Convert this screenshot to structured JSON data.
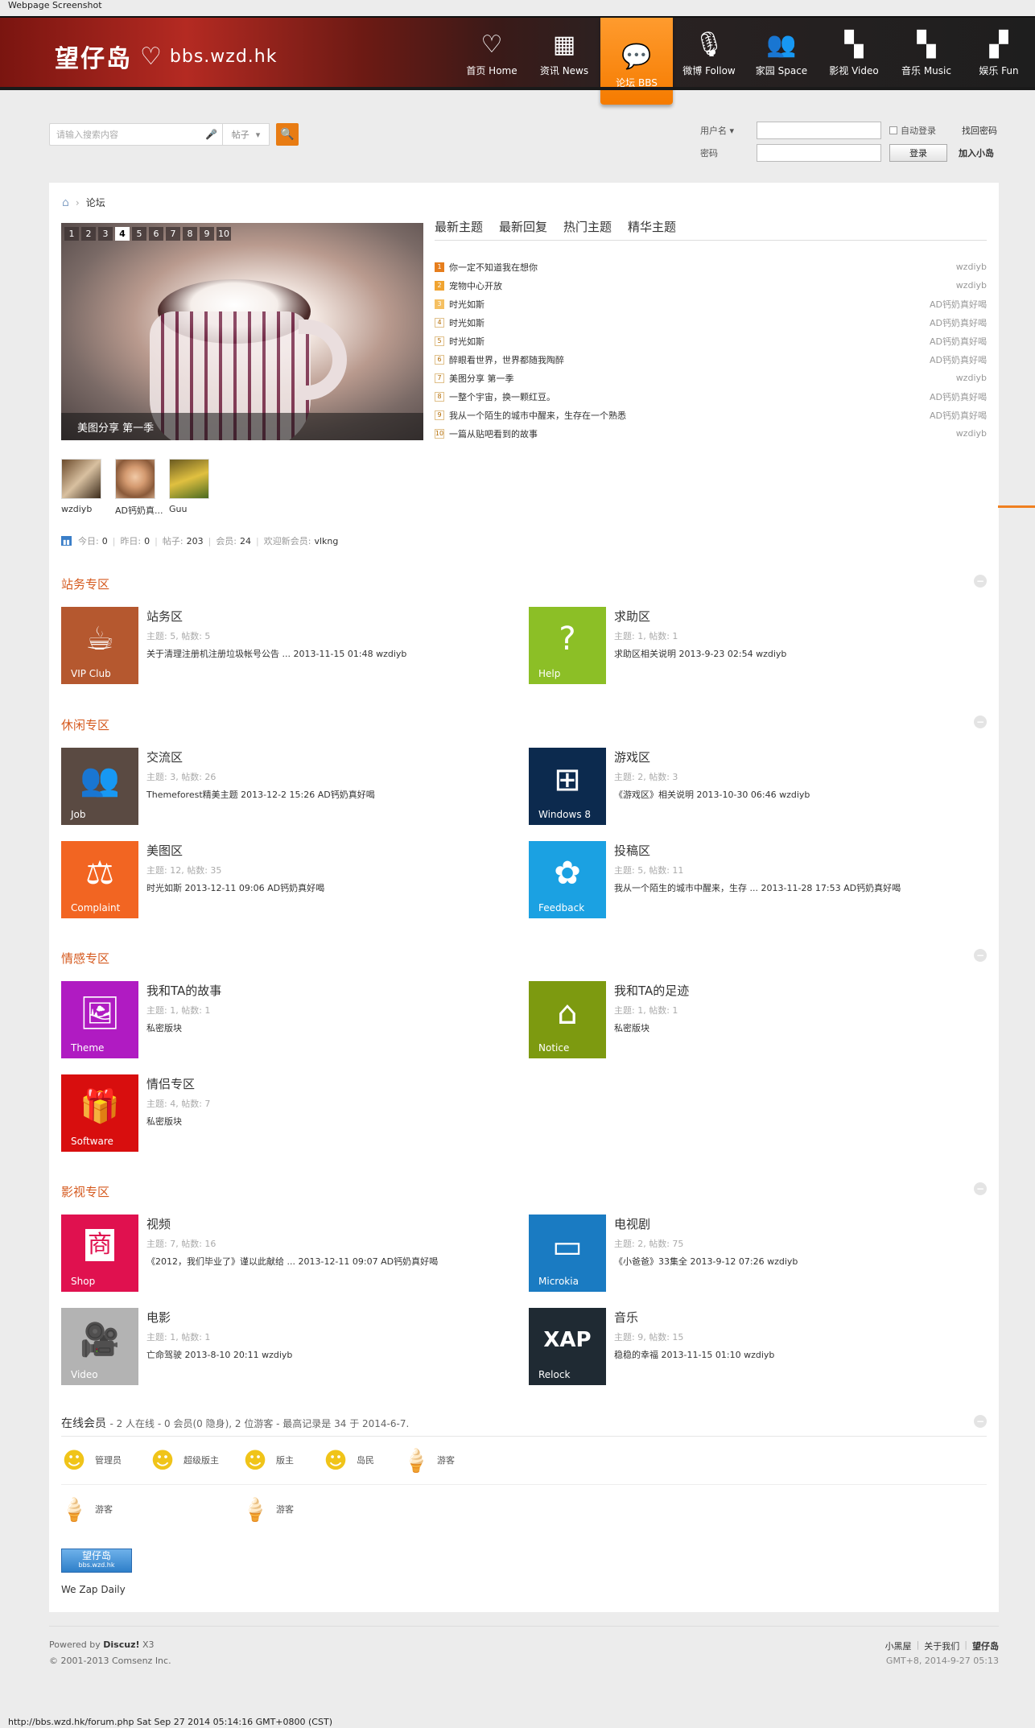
{
  "caption": "Webpage Screenshot",
  "status_line": "http://bbs.wzd.hk/forum.php Sat Sep 27 2014 05:14:16 GMT+0800 (CST)",
  "header": {
    "logo_cn": "望仔岛",
    "logo_domain": "bbs.wzd.hk",
    "nav": [
      {
        "label": "首页 Home",
        "icon": "heart-icon"
      },
      {
        "label": "资讯 News",
        "icon": "grid-icon"
      },
      {
        "label": "论坛 BBS",
        "icon": "chat-bubbles-icon",
        "active": true
      },
      {
        "label": "微博 Follow",
        "icon": "microphone-icon"
      },
      {
        "label": "家园 Space",
        "icon": "users-icon"
      },
      {
        "label": "影视 Video",
        "icon": "tiles-icon"
      },
      {
        "label": "音乐 Music",
        "icon": "tiles-icon"
      },
      {
        "label": "娱乐 Fun",
        "icon": "tiles-icon"
      }
    ]
  },
  "search": {
    "placeholder": "请输入搜索内容",
    "type": "帖子"
  },
  "login": {
    "username_label": "用户名",
    "password_label": "密码",
    "auto_login": "自动登录",
    "submit": "登录",
    "forgot": "找回密码",
    "register": "加入小岛"
  },
  "breadcrumb": {
    "current": "论坛"
  },
  "slider": {
    "pages": [
      "1",
      "2",
      "3",
      "4",
      "5",
      "6",
      "7",
      "8",
      "9",
      "10"
    ],
    "active_page": "4",
    "caption": "美图分享 第一季"
  },
  "tabs": [
    "最新主题",
    "最新回复",
    "热门主题",
    "精华主题"
  ],
  "topics": [
    {
      "num": "1",
      "title": "你一定不知道我在想你",
      "author": "wzdiyb"
    },
    {
      "num": "2",
      "title": "宠物中心开放",
      "author": "wzdiyb"
    },
    {
      "num": "3",
      "title": "时光如斯",
      "author": "AD钙奶真好喝"
    },
    {
      "num": "4",
      "title": "时光如斯",
      "author": "AD钙奶真好喝"
    },
    {
      "num": "5",
      "title": "时光如斯",
      "author": "AD钙奶真好喝"
    },
    {
      "num": "6",
      "title": "醉眼看世界，世界都随我陶醉",
      "author": "AD钙奶真好喝"
    },
    {
      "num": "7",
      "title": "美图分享 第一季",
      "author": "wzdiyb"
    },
    {
      "num": "8",
      "title": "一整个宇宙，换一颗红豆。",
      "author": "AD钙奶真好喝"
    },
    {
      "num": "9",
      "title": "我从一个陌生的城市中醒来，生存在一个熟悉",
      "author": "AD钙奶真好喝"
    },
    {
      "num": "10",
      "title": "一篇从贴吧看到的故事",
      "author": "wzdiyb"
    }
  ],
  "avatars": [
    {
      "name": "wzdiyb"
    },
    {
      "name": "AD钙奶真..."
    },
    {
      "name": "Guu"
    }
  ],
  "stats": {
    "today_label": "今日:",
    "today": "0",
    "yesterday_label": "昨日:",
    "yesterday": "0",
    "posts_label": "帖子:",
    "posts": "203",
    "members_label": "会员:",
    "members": "24",
    "newest_label": "欢迎新会员:",
    "newest": "vlkng"
  },
  "sections": [
    {
      "title": "站务专区"
    },
    {
      "title": "休闲专区"
    },
    {
      "title": "情感专区"
    },
    {
      "title": "影视专区"
    }
  ],
  "forums": [
    {
      "name": "站务区",
      "meta": "主题: 5, 帖数: 5",
      "last": "关于清理注册机注册垃圾帐号公告 ... 2013-11-15 01:48 wzdiyb",
      "tile_label": "VIP Club",
      "tile_color": "#b5582f",
      "icon": "cup-icon",
      "glyph": "☕"
    },
    {
      "name": "求助区",
      "meta": "主题: 1, 帖数: 1",
      "last": "求助区相关说明 2013-9-23 02:54 wzdiyb",
      "tile_label": "Help",
      "tile_color": "#8cbf26",
      "icon": "help-icon",
      "glyph": "?"
    },
    {
      "name": "交流区",
      "meta": "主题: 3, 帖数: 26",
      "last": "Themeforest精美主题 2013-12-2 15:26 AD钙奶真好喝",
      "tile_label": "Job",
      "tile_color": "#5a4a42",
      "icon": "people-icon",
      "glyph": "👥"
    },
    {
      "name": "游戏区",
      "meta": "主题: 2, 帖数: 3",
      "last": "《游戏区》相关说明 2013-10-30 06:46 wzdiyb",
      "tile_label": "Windows 8",
      "tile_color": "#0c2a4e",
      "icon": "windows-icon",
      "glyph": "⊞"
    },
    {
      "name": "美图区",
      "meta": "主题: 12, 帖数: 35",
      "last": "时光如斯 2013-12-11 09:06 AD钙奶真好喝",
      "tile_label": "Complaint",
      "tile_color": "#f26522",
      "icon": "scales-icon",
      "glyph": "⚖"
    },
    {
      "name": "投稿区",
      "meta": "主题: 5, 帖数: 11",
      "last": "我从一个陌生的城市中醒来，生存 ... 2013-11-28 17:53 AD钙奶真好喝",
      "tile_label": "Feedback",
      "tile_color": "#1ba1e2",
      "icon": "plant-icon",
      "glyph": "✿"
    },
    {
      "name": "我和TA的故事",
      "meta": "主题: 1, 帖数: 1",
      "last": "私密版块",
      "tile_label": "Theme",
      "tile_color": "#b01bc2",
      "icon": "picture-icon",
      "glyph": "🖼"
    },
    {
      "name": "我和TA的足迹",
      "meta": "主题: 1, 帖数: 1",
      "last": "私密版块",
      "tile_label": "Notice",
      "tile_color": "#7d9a10",
      "icon": "home-icon",
      "glyph": "⌂"
    },
    {
      "name": "情侣专区",
      "meta": "主题: 4, 帖数: 7",
      "last": "私密版块",
      "tile_label": "Software",
      "tile_color": "#d80e0e",
      "icon": "gift-icon",
      "glyph": "🎁"
    },
    {
      "name": "视频",
      "meta": "主题: 7, 帖数: 16",
      "last": "《2012，我们毕业了》谨以此献给 ... 2013-12-11 09:07 AD钙奶真好喝",
      "tile_label": "Shop",
      "tile_color": "#e0114f",
      "icon": "shop-icon",
      "glyph": "商"
    },
    {
      "name": "电视剧",
      "meta": "主题: 2, 帖数: 75",
      "last": "《小爸爸》33集全 2013-9-12 07:26 wzdiyb",
      "tile_label": "Microkia",
      "tile_color": "#1a7bc2",
      "icon": "phone-icon",
      "glyph": "▭"
    },
    {
      "name": "电影",
      "meta": "主题: 1, 帖数: 1",
      "last": "亡命驾驶 2013-8-10 20:11 wzdiyb",
      "tile_label": "Video",
      "tile_color": "#b3b3b3",
      "icon": "camera-icon",
      "glyph": "🎥"
    },
    {
      "name": "音乐",
      "meta": "主题: 9, 帖数: 15",
      "last": "稳稳的幸福 2013-11-15 01:10 wzdiyb",
      "tile_label": "Relock",
      "tile_color": "#1f2a33",
      "icon": "xap-icon",
      "glyph": "XAP"
    }
  ],
  "online": {
    "title": "在线会员",
    "summary": "- 2 人在线 - 0 会员(0 隐身), 2 位游客 - 最高记录是 34 于 2014-6-7.",
    "legend": [
      {
        "label": "管理员",
        "icon": "minion-icon"
      },
      {
        "label": "超级版主",
        "icon": "minion-icon"
      },
      {
        "label": "版主",
        "icon": "minion-icon"
      },
      {
        "label": "岛民",
        "icon": "minion-icon"
      },
      {
        "label": "游客",
        "icon": "ice-cream-icon"
      }
    ],
    "users": [
      {
        "label": "游客",
        "icon": "ice-cream-icon"
      },
      {
        "label": "游客",
        "icon": "ice-cream-icon"
      }
    ]
  },
  "friend_link": {
    "logo_text": "望仔岛",
    "logo_sub": "bbs.wzd.hk",
    "name": "We Zap Daily"
  },
  "footer": {
    "powered_prefix": "Powered by",
    "powered_name": "Discuz!",
    "powered_ver": "X3",
    "copyright": "© 2001-2013 Comsenz Inc.",
    "links": [
      "小黑屋",
      "关于我们",
      "望仔岛"
    ],
    "time": "GMT+8, 2014-9-27 05:13"
  }
}
